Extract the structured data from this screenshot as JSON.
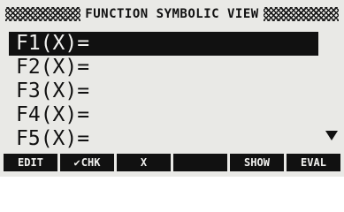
{
  "header": {
    "title": "FUNCTION SYMBOLIC VIEW"
  },
  "functions": [
    {
      "label": "F1(X)=",
      "selected": true
    },
    {
      "label": "F2(X)=",
      "selected": false
    },
    {
      "label": "F3(X)=",
      "selected": false
    },
    {
      "label": "F4(X)=",
      "selected": false
    },
    {
      "label": "F5(X)=",
      "selected": false
    }
  ],
  "scroll_indicator": "scroll-down-arrow-icon",
  "menu": {
    "keys": [
      {
        "label": "EDIT"
      },
      {
        "label": "CHK",
        "icon": "checkmark-icon",
        "icon_glyph": "✔"
      },
      {
        "label": "X"
      },
      {
        "label": ""
      },
      {
        "label": "SHOW"
      },
      {
        "label": "EVAL"
      }
    ]
  }
}
